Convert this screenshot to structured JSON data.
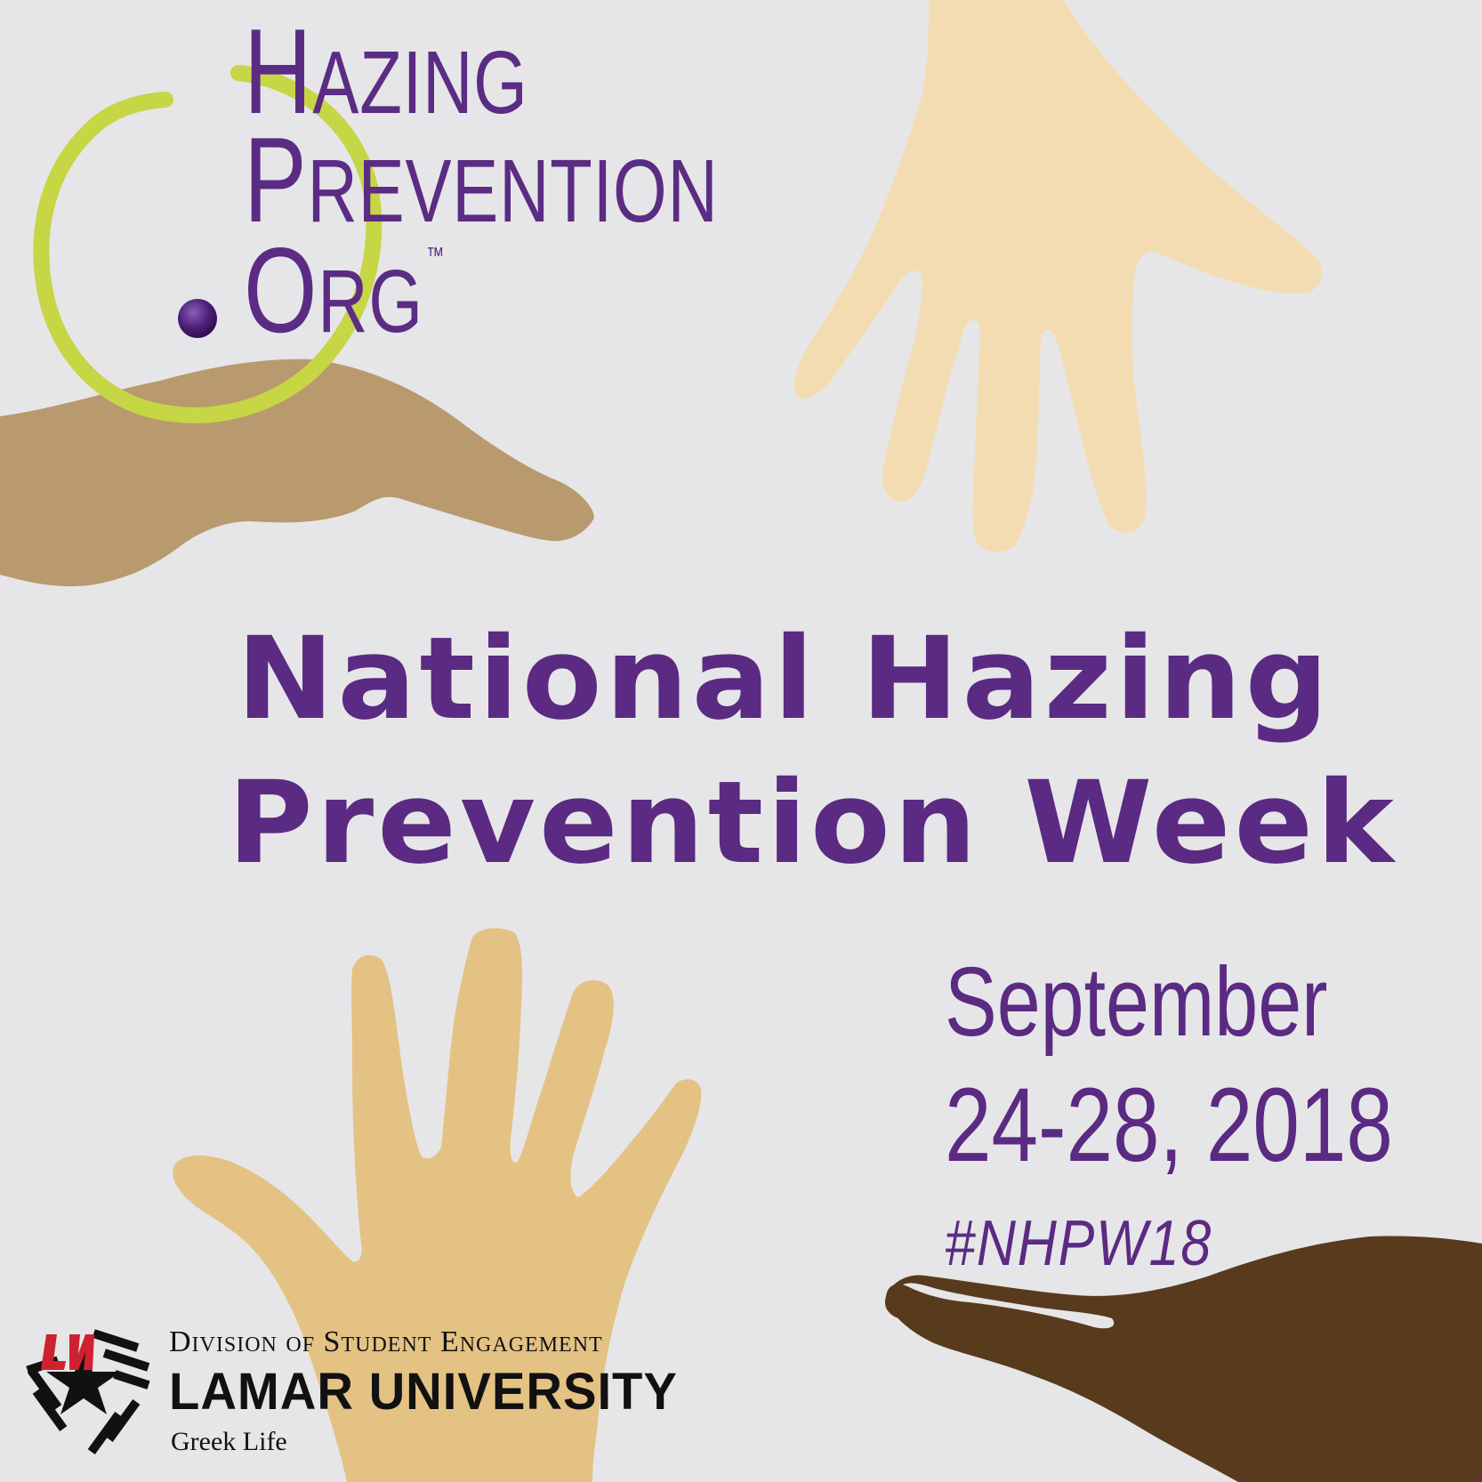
{
  "colors": {
    "background": "#e6e6e8",
    "brand_purple": "#5b2a82",
    "circle_green": "#c6d645",
    "hand_tan": "#b89a6e",
    "hand_light": "#f4dcb2",
    "hand_gold": "#e4c284",
    "hand_dark": "#583a1d",
    "lamar_red": "#cf2230"
  },
  "logo": {
    "line1_first": "H",
    "line1_rest": "AZING",
    "line2_first": "P",
    "line2_rest": "REVENTION",
    "line3_first": "O",
    "line3_rest": "RG",
    "trademark": "™",
    "icon": "green-circle-with-purple-dot"
  },
  "headline": {
    "line1": "National Hazing",
    "line2": "Prevention Week"
  },
  "event": {
    "month": "September",
    "days": "24-28, 2018",
    "hashtag": "#NHPW18"
  },
  "sponsor": {
    "division": "Division of Student Engagement",
    "university": "LAMAR UNIVERSITY",
    "department": "Greek Life",
    "registered": "®",
    "logo_letters": "LU"
  }
}
